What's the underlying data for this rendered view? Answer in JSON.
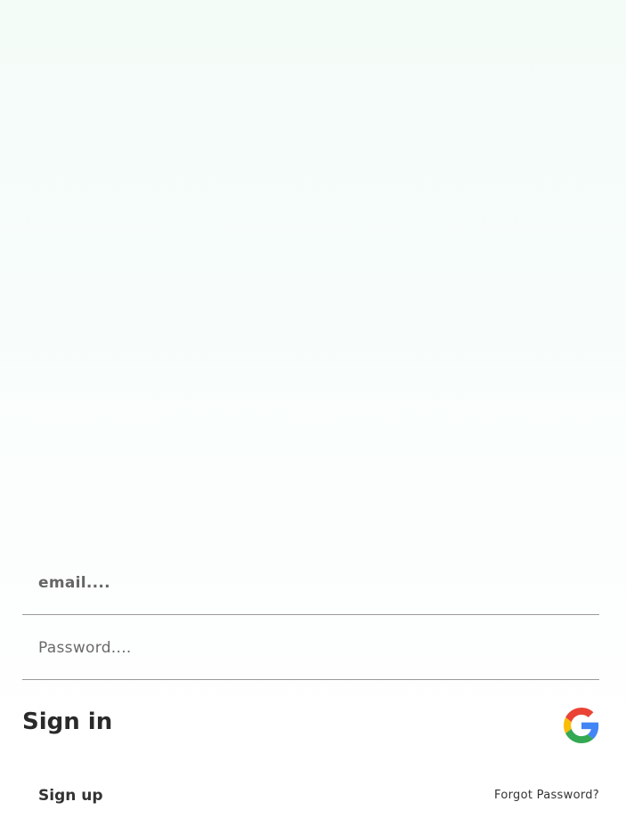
{
  "login": {
    "email": {
      "value": "",
      "placeholder": "email...."
    },
    "password": {
      "value": "",
      "placeholder": "Password...."
    },
    "signin_label": "Sign in",
    "google_icon": "google-g-icon",
    "signup_label": "Sign up",
    "forgot_label": "Forgot Password?"
  },
  "colors": {
    "background_top": "#f4fcf8",
    "background_bottom": "#ffffff",
    "google_blue": "#4285F4",
    "google_red": "#EA4335",
    "google_yellow": "#FBBC05",
    "google_green": "#34A853"
  }
}
